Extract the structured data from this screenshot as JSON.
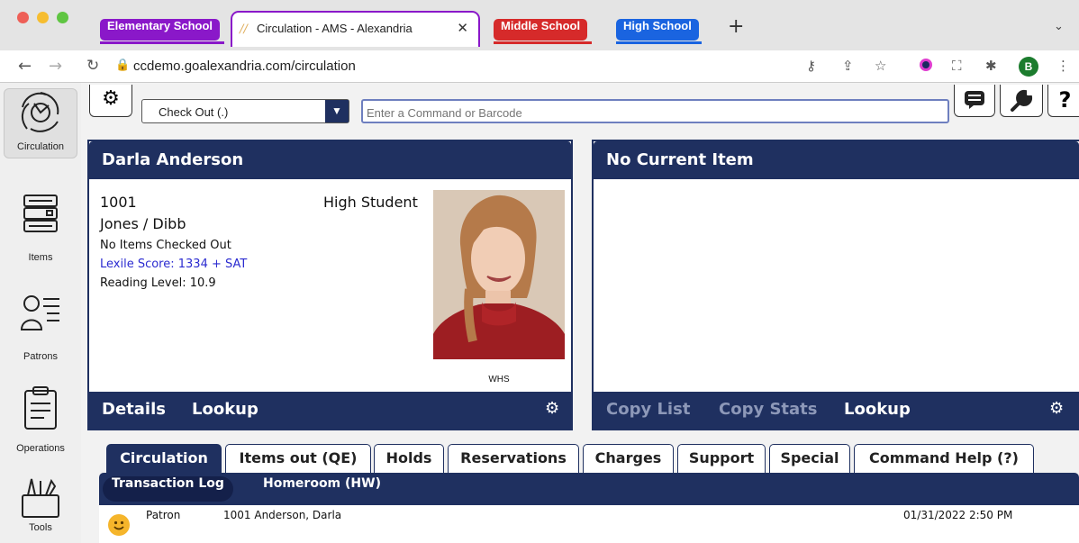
{
  "browser": {
    "tab_groups": [
      {
        "label": "Elementary School",
        "color": "#8a18c9"
      },
      {
        "label": "Middle School",
        "color": "#d62a2a"
      },
      {
        "label": "High School",
        "color": "#1a64e0"
      }
    ],
    "active_tab_title": "Circulation - AMS - Alexandria",
    "new_tab": "+",
    "url": "ccdemo.goalexandria.com/circulation",
    "profile_initial": "B"
  },
  "sidebar": {
    "items": [
      {
        "label": "Circulation",
        "icon": "circulation-logo-icon"
      },
      {
        "label": "Items",
        "icon": "books-icon"
      },
      {
        "label": "Patrons",
        "icon": "patron-list-icon"
      },
      {
        "label": "Operations",
        "icon": "clipboard-icon"
      },
      {
        "label": "Tools",
        "icon": "tools-icon"
      }
    ]
  },
  "toolbar": {
    "mode_select": "Check Out (.)",
    "command_placeholder": "Enter a Command or Barcode"
  },
  "patron_panel": {
    "name": "Darla Anderson",
    "id": "1001",
    "type": "High Student",
    "homeroom": "Jones / Dibb",
    "items_status": "No Items Checked Out",
    "lexile": "Lexile Score: 1334 + SAT",
    "reading_level": "Reading Level: 10.9",
    "photo_caption": "WHS",
    "footer_links": [
      "Details",
      "Lookup"
    ]
  },
  "item_panel": {
    "title": "No Current Item",
    "footer_links": [
      "Copy List",
      "Copy Stats",
      "Lookup"
    ]
  },
  "tabs": [
    "Circulation",
    "Items out (QE)",
    "Holds",
    "Reservations",
    "Charges",
    "Support",
    "Special",
    "Command Help (?)"
  ],
  "subtabs": [
    "Transaction Log",
    "Homeroom (HW)"
  ],
  "log": [
    {
      "type": "Patron",
      "detail": "1001 Anderson, Darla",
      "time": "01/31/2022 2:50 PM"
    }
  ]
}
